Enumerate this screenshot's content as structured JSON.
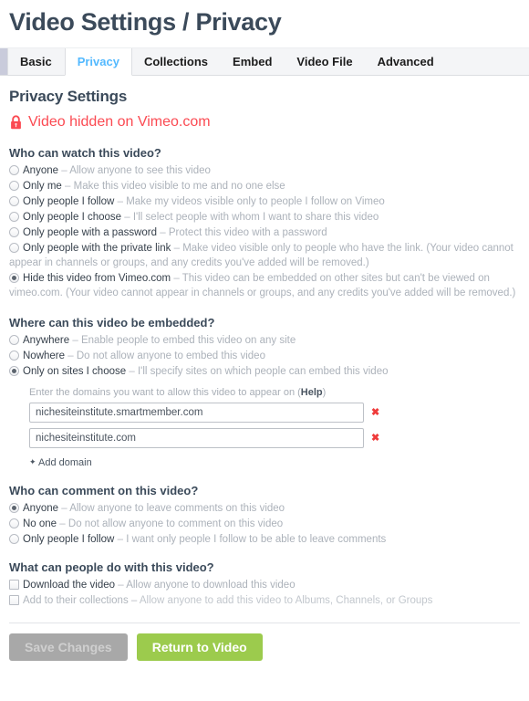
{
  "header": {
    "title": "Video Settings / Privacy"
  },
  "tabs": [
    {
      "label": "Basic",
      "active": false
    },
    {
      "label": "Privacy",
      "active": true
    },
    {
      "label": "Collections",
      "active": false
    },
    {
      "label": "Embed",
      "active": false
    },
    {
      "label": "Video File",
      "active": false
    },
    {
      "label": "Advanced",
      "active": false
    }
  ],
  "section": {
    "title": "Privacy Settings",
    "notice": {
      "icon": "lock-icon",
      "text": "Video hidden on Vimeo.com",
      "color": "#fb4a52"
    }
  },
  "watch": {
    "title": "Who can watch this video?",
    "options": [
      {
        "label": "Anyone",
        "desc": "Allow anyone to see this video",
        "selected": false
      },
      {
        "label": "Only me",
        "desc": "Make this video visible to me and no one else",
        "selected": false
      },
      {
        "label": "Only people I follow",
        "desc": "Make my videos visible only to people I follow on Vimeo",
        "selected": false
      },
      {
        "label": "Only people I choose",
        "desc": "I'll select people with whom I want to share this video",
        "selected": false
      },
      {
        "label": "Only people with a password",
        "desc": "Protect this video with a password",
        "selected": false
      },
      {
        "label": "Only people with the private link",
        "desc": "Make video visible only to people who have the link. (Your video cannot appear in channels or groups, and any credits you've added will be removed.)",
        "selected": false
      },
      {
        "label": "Hide this video from Vimeo.com",
        "desc": "This video can be embedded on other sites but can't be viewed on vimeo.com. (Your video cannot appear in channels or groups, and any credits you've added will be removed.)",
        "selected": true
      }
    ]
  },
  "embed": {
    "title": "Where can this video be embedded?",
    "options": [
      {
        "label": "Anywhere",
        "desc": "Enable people to embed this video on any site",
        "selected": false
      },
      {
        "label": "Nowhere",
        "desc": "Do not allow anyone to embed this video",
        "selected": false
      },
      {
        "label": "Only on sites I choose",
        "desc": "I'll specify sites on which people can embed this video",
        "selected": true
      }
    ],
    "domains_label_before": "Enter the domains you want to allow this video to appear on (",
    "domains_help": "Help",
    "domains_label_after": ")",
    "domains": [
      {
        "value": "nichesiteinstitute.smartmember.com",
        "remove": "✖"
      },
      {
        "value": "nichesiteinstitute.com",
        "remove": "✖"
      }
    ],
    "add_domain": "Add domain",
    "add_domain_plus": "✦"
  },
  "comment": {
    "title": "Who can comment on this video?",
    "options": [
      {
        "label": "Anyone",
        "desc": "Allow anyone to leave comments on this video",
        "selected": true
      },
      {
        "label": "No one",
        "desc": "Do not allow anyone to comment on this video",
        "selected": false
      },
      {
        "label": "Only people I follow",
        "desc": "I want only people I follow to be able to leave comments",
        "selected": false
      }
    ]
  },
  "actions_group": {
    "title": "What can people do with this video?",
    "options": [
      {
        "label": "Download the video",
        "desc": "Allow anyone to download this video",
        "checked": false,
        "disabled": false
      },
      {
        "label": "Add to their collections",
        "desc": "Allow anyone to add this video to Albums, Channels, or Groups",
        "checked": false,
        "disabled": true
      }
    ]
  },
  "footer": {
    "save_label": "Save Changes",
    "save_disabled": true,
    "return_label": "Return to Video",
    "return_color": "#9ccb4d"
  }
}
